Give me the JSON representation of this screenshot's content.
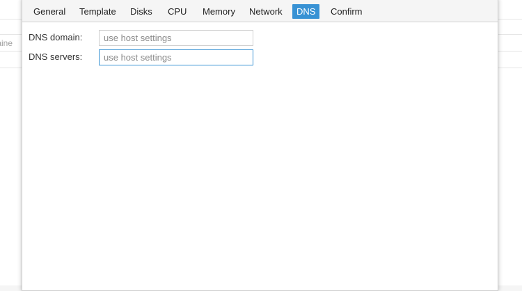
{
  "background": {
    "partial_text": "taine"
  },
  "tabs": [
    {
      "label": "General",
      "active": false
    },
    {
      "label": "Template",
      "active": false
    },
    {
      "label": "Disks",
      "active": false
    },
    {
      "label": "CPU",
      "active": false
    },
    {
      "label": "Memory",
      "active": false
    },
    {
      "label": "Network",
      "active": false
    },
    {
      "label": "DNS",
      "active": true
    },
    {
      "label": "Confirm",
      "active": false
    }
  ],
  "form": {
    "dns_domain": {
      "label": "DNS domain:",
      "value": "",
      "placeholder": "use host settings"
    },
    "dns_servers": {
      "label": "DNS servers:",
      "value": "",
      "placeholder": "use host settings",
      "focused": true
    }
  },
  "colors": {
    "accent": "#3892d4",
    "border": "#cfcfcf"
  }
}
